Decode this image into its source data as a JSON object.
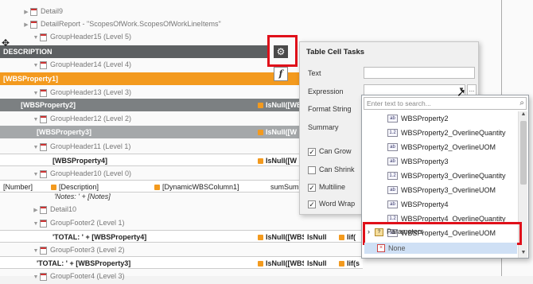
{
  "tree": {
    "detail9": "Detail9",
    "detail_report": "DetailReport - \"ScopesOfWork.ScopesOfWorkLineItems\"",
    "gh15": "GroupHeader15 (Level 5)",
    "gh14": "GroupHeader14 (Level 4)",
    "gh13": "GroupHeader13 (Level 3)",
    "gh12": "GroupHeader12 (Level 2)",
    "gh11": "GroupHeader11 (Level 1)",
    "gh10": "GroupHeader10 (Level 0)",
    "detail10": "Detail10",
    "gf2": "GroupFooter2 (Level 1)",
    "gf3": "GroupFooter3 (Level 2)",
    "gf4": "GroupFooter4 (Level 3)"
  },
  "cells": {
    "description": "DESCRIPTION",
    "wbs1": "[WBSProperty1]",
    "wbs2": "[WBSProperty2]",
    "isnull2": "IsNull([WB",
    "wbs3": "[WBSProperty3]",
    "isnull3": "IsNull([W",
    "wbs4": "[WBSProperty4]",
    "isnull4": "IsNull([W",
    "number": "[Number]",
    "desc_field": "[Description]",
    "dynamic": "[DynamicWBSColumn1]",
    "sumsum": "sumSum",
    "notes": "'Notes: ' + [Notes]",
    "total4": "'TOTAL: ' + [WBSProperty4]",
    "total4_b": "IsNull([WBS",
    "total4_c": "IsNull",
    "total4_d": "Iif(",
    "total3": "'TOTAL: ' + [WBSProperty3]",
    "total3_b": "IsNull([WBS",
    "total3_c": "IsNull",
    "total3_d": "Iif(s"
  },
  "panel": {
    "title": "Table Cell Tasks",
    "text_label": "Text",
    "expression_label": "Expression",
    "format_label": "Format String",
    "summary_label": "Summary",
    "can_grow": "Can Grow",
    "can_shrink": "Can Shrink",
    "multiline": "Multiline",
    "word_wrap": "Word Wrap",
    "dots": "..."
  },
  "dropdown": {
    "search_placeholder": "Enter text to search...",
    "items": [
      {
        "icon": "ab",
        "label": "WBSProperty2"
      },
      {
        "icon": "1.2",
        "label": "WBSProperty2_OverlineQuantity"
      },
      {
        "icon": "ab",
        "label": "WBSProperty2_OverlineUOM"
      },
      {
        "icon": "ab",
        "label": "WBSProperty3"
      },
      {
        "icon": "1.2",
        "label": "WBSProperty3_OverlineQuantity"
      },
      {
        "icon": "ab",
        "label": "WBSProperty3_OverlineUOM"
      },
      {
        "icon": "ab",
        "label": "WBSProperty4"
      },
      {
        "icon": "1.2",
        "label": "WBSProperty4_OverlineQuantity"
      },
      {
        "icon": "ab",
        "label": "WBSProperty4_OverlineUOM"
      }
    ],
    "parameters": "Parameters",
    "none": "None"
  }
}
